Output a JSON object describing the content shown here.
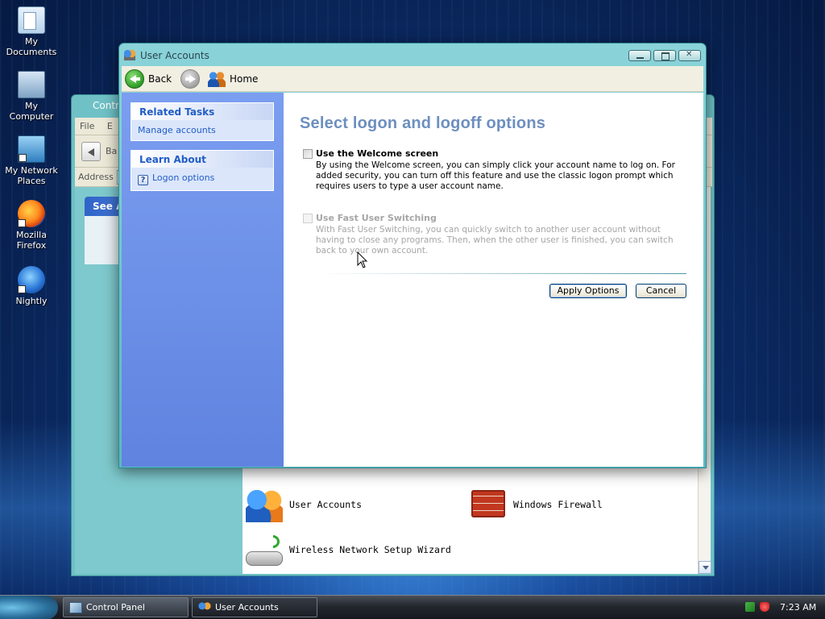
{
  "desktop": {
    "icons": [
      {
        "label_line1": "My",
        "label_line2": "Documents",
        "icon": "my-documents-icon"
      },
      {
        "label_line1": "My",
        "label_line2": "Computer",
        "icon": "my-computer-icon"
      },
      {
        "label_line1": "My Network",
        "label_line2": "Places",
        "icon": "network-places-icon"
      },
      {
        "label_line1": "Mozilla",
        "label_line2": "Firefox",
        "icon": "firefox-icon"
      },
      {
        "label_line1": "Nightly",
        "label_line2": "",
        "icon": "nightly-icon"
      }
    ]
  },
  "control_panel": {
    "title": "Contr",
    "menu": [
      "File",
      "E"
    ],
    "back_label": "Ba",
    "address_label": "Address",
    "see_also": "See A",
    "items": [
      {
        "label": "User Accounts",
        "icon": "user-accounts-icon"
      },
      {
        "label": "Windows Firewall",
        "icon": "windows-firewall-icon"
      },
      {
        "label": "Wireless Network Setup Wizard",
        "icon": "wireless-wizard-icon"
      }
    ]
  },
  "user_accounts": {
    "title": "User Accounts",
    "toolbar": {
      "back_label": "Back",
      "home_label": "Home"
    },
    "related_tasks": {
      "heading": "Related Tasks",
      "links": [
        "Manage accounts"
      ]
    },
    "learn_about": {
      "heading": "Learn About",
      "links": [
        "Logon options"
      ]
    },
    "heading": "Select logon and logoff options",
    "options": [
      {
        "title": "Use the Welcome screen",
        "description": "By using the Welcome screen, you can simply click your account name to log on. For added security, you can turn off this feature and use the classic logon prompt which requires users to type a user account name.",
        "checked": false,
        "enabled": true
      },
      {
        "title": "Use Fast User Switching",
        "description": "With Fast User Switching, you can quickly switch to another user account without having to close any programs. Then, when the other user is finished, you can switch back to your own account.",
        "checked": false,
        "enabled": false
      }
    ],
    "buttons": {
      "apply": "Apply Options",
      "cancel": "Cancel"
    }
  },
  "taskbar": {
    "buttons": [
      {
        "label": "Control Panel",
        "active": false
      },
      {
        "label": "User Accounts",
        "active": true
      }
    ],
    "clock": "7:23 AM"
  },
  "colors": {
    "link": "#215dc6",
    "heading": "#6d8fbf",
    "task_pane": "#6f92e8",
    "window_frame": "#6fc1c6"
  }
}
